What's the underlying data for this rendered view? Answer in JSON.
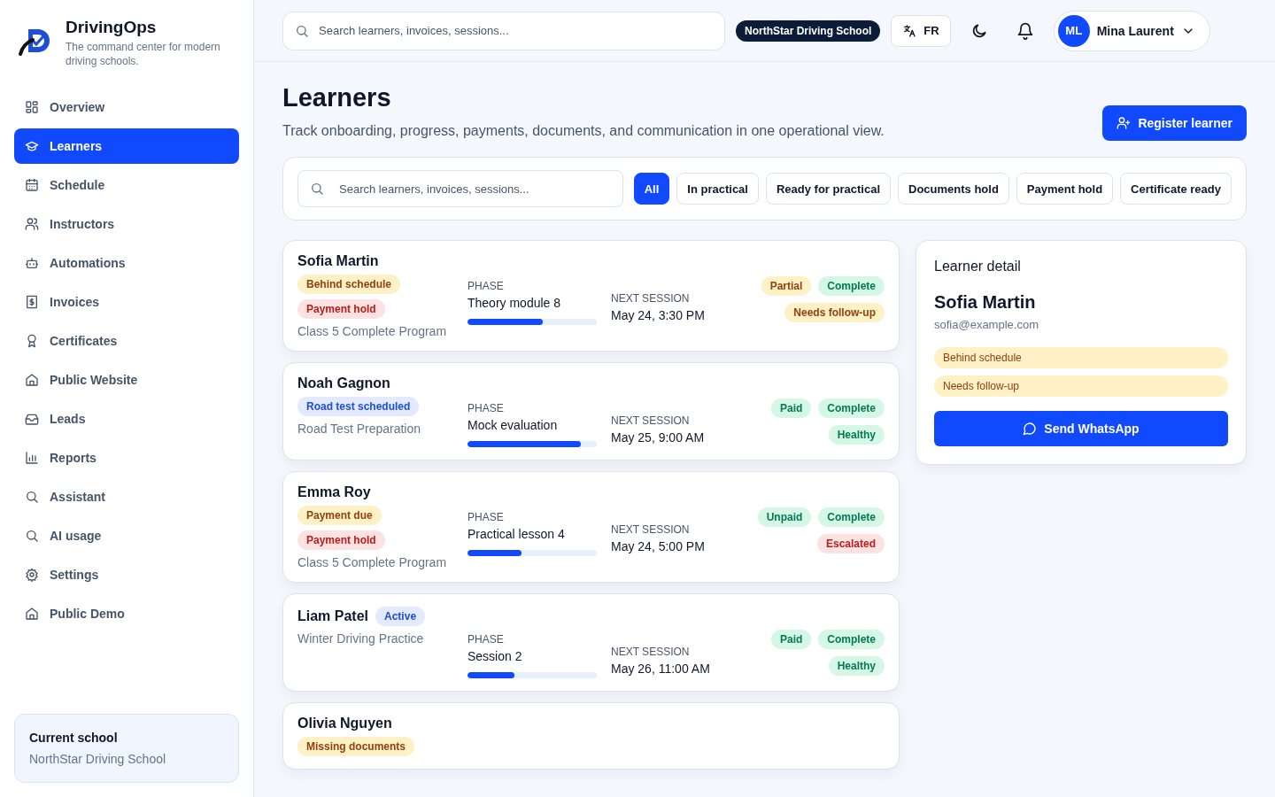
{
  "brand": {
    "name": "DrivingOps",
    "tagline": "The command center for modern driving schools."
  },
  "sidebar": {
    "items": [
      {
        "label": "Overview",
        "selected": false
      },
      {
        "label": "Learners",
        "selected": true
      },
      {
        "label": "Schedule",
        "selected": false
      },
      {
        "label": "Instructors",
        "selected": false
      },
      {
        "label": "Automations",
        "selected": false
      },
      {
        "label": "Invoices",
        "selected": false
      },
      {
        "label": "Certificates",
        "selected": false
      },
      {
        "label": "Public Website",
        "selected": false
      },
      {
        "label": "Leads",
        "selected": false
      },
      {
        "label": "Reports",
        "selected": false
      },
      {
        "label": "Assistant",
        "selected": false
      },
      {
        "label": "AI usage",
        "selected": false
      },
      {
        "label": "Settings",
        "selected": false
      },
      {
        "label": "Public Demo",
        "selected": false
      }
    ],
    "current_school": {
      "label": "Current school",
      "value": "NorthStar Driving School"
    }
  },
  "topbar": {
    "search": {
      "placeholder": "Search learners, invoices, sessions..."
    },
    "school_badge": "NorthStar Driving School",
    "language": "FR",
    "user": {
      "initials": "ML",
      "name": "Mina Laurent"
    }
  },
  "page": {
    "title": "Learners",
    "subtitle": "Track onboarding, progress, payments, documents, and communication in one operational view.",
    "primary_action": "Register learner"
  },
  "filters": {
    "search": {
      "placeholder": "Search learners, invoices, sessions..."
    },
    "chips": [
      {
        "label": "All",
        "selected": true
      },
      {
        "label": "In practical",
        "selected": false
      },
      {
        "label": "Ready for practical",
        "selected": false
      },
      {
        "label": "Documents hold",
        "selected": false
      },
      {
        "label": "Payment hold",
        "selected": false
      },
      {
        "label": "Certificate ready",
        "selected": false
      }
    ]
  },
  "learners": [
    {
      "name": "Sofia Martin",
      "tags": [
        {
          "label": "Behind schedule",
          "kind": "warning"
        },
        {
          "label": "Payment hold",
          "kind": "danger"
        }
      ],
      "program": "Class 5 Complete Program",
      "phase_label": "PHASE",
      "phase": "Theory module 8",
      "level": 0.58,
      "session_label": "NEXT SESSION",
      "session": "May 24, 3:30 PM",
      "statuses": [
        {
          "label": "Partial",
          "kind": "warning"
        },
        {
          "label": "Complete",
          "kind": "success"
        },
        {
          "label": "Needs follow-up",
          "kind": "warning"
        }
      ]
    },
    {
      "name": "Noah Gagnon",
      "tags": [
        {
          "label": "Road test scheduled",
          "kind": "info"
        }
      ],
      "program": "Road Test Preparation",
      "phase_label": "PHASE",
      "phase": "Mock evaluation",
      "level": 0.88,
      "session_label": "NEXT SESSION",
      "session": "May 25, 9:00 AM",
      "statuses": [
        {
          "label": "Paid",
          "kind": "success"
        },
        {
          "label": "Complete",
          "kind": "success"
        },
        {
          "label": "Healthy",
          "kind": "success"
        }
      ]
    },
    {
      "name": "Emma Roy",
      "tags": [
        {
          "label": "Payment due",
          "kind": "warning"
        },
        {
          "label": "Payment hold",
          "kind": "danger"
        }
      ],
      "program": "Class 5 Complete Program",
      "phase_label": "PHASE",
      "phase": "Practical lesson 4",
      "level": 0.42,
      "session_label": "NEXT SESSION",
      "session": "May 24, 5:00 PM",
      "statuses": [
        {
          "label": "Unpaid",
          "kind": "success"
        },
        {
          "label": "Complete",
          "kind": "success"
        },
        {
          "label": "Escalated",
          "kind": "danger"
        }
      ]
    },
    {
      "name": "Liam Patel",
      "inline_tags": [
        {
          "label": "Active",
          "kind": "info"
        }
      ],
      "program": "Winter Driving Practice",
      "phase_label": "PHASE",
      "phase": "Session 2",
      "level": 0.36,
      "session_label": "NEXT SESSION",
      "session": "May 26, 11:00 AM",
      "statuses": [
        {
          "label": "Paid",
          "kind": "success"
        },
        {
          "label": "Complete",
          "kind": "success"
        },
        {
          "label": "Healthy",
          "kind": "success"
        }
      ]
    },
    {
      "name": "Olivia Nguyen",
      "tags": [
        {
          "label": "Missing documents",
          "kind": "warning"
        }
      ]
    }
  ],
  "detail": {
    "heading": "Learner detail",
    "name": "Sofia Martin",
    "email": "sofia@example.com",
    "tags": [
      {
        "label": "Behind schedule",
        "kind": "warning"
      },
      {
        "label": "Needs follow-up",
        "kind": "warning"
      }
    ],
    "action": "Send WhatsApp"
  }
}
